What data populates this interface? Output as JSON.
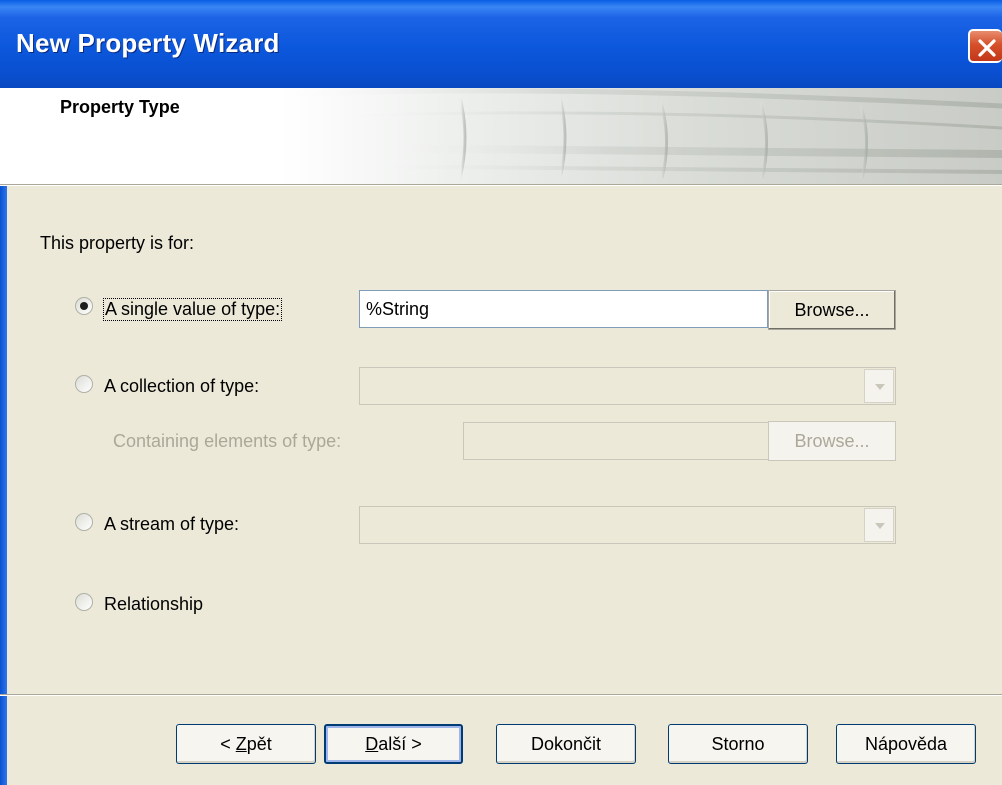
{
  "window": {
    "title": "New Property Wizard",
    "close_icon": "close-icon"
  },
  "header": {
    "title": "Property Type"
  },
  "body": {
    "intro": "This property is for:",
    "options": {
      "single": {
        "label": "A single value of type:",
        "checked": true,
        "value": "%String",
        "browse": "Browse..."
      },
      "collection": {
        "label": "A collection of type:",
        "checked": false,
        "value": "",
        "containing_label": "Containing elements of type:",
        "containing_value": "",
        "browse": "Browse..."
      },
      "stream": {
        "label": "A stream of type:",
        "checked": false,
        "value": ""
      },
      "relationship": {
        "label": "Relationship",
        "checked": false
      }
    }
  },
  "footer": {
    "back": {
      "pre": "< ",
      "accel": "Z",
      "post": "pět"
    },
    "next": {
      "accel": "D",
      "post": "alší >"
    },
    "finish": "Dokončit",
    "cancel": "Storno",
    "help": "Nápověda"
  },
  "colors": {
    "titlebar": "#0a57dc",
    "face": "#ece9d8",
    "disabled_text": "#aca899"
  }
}
